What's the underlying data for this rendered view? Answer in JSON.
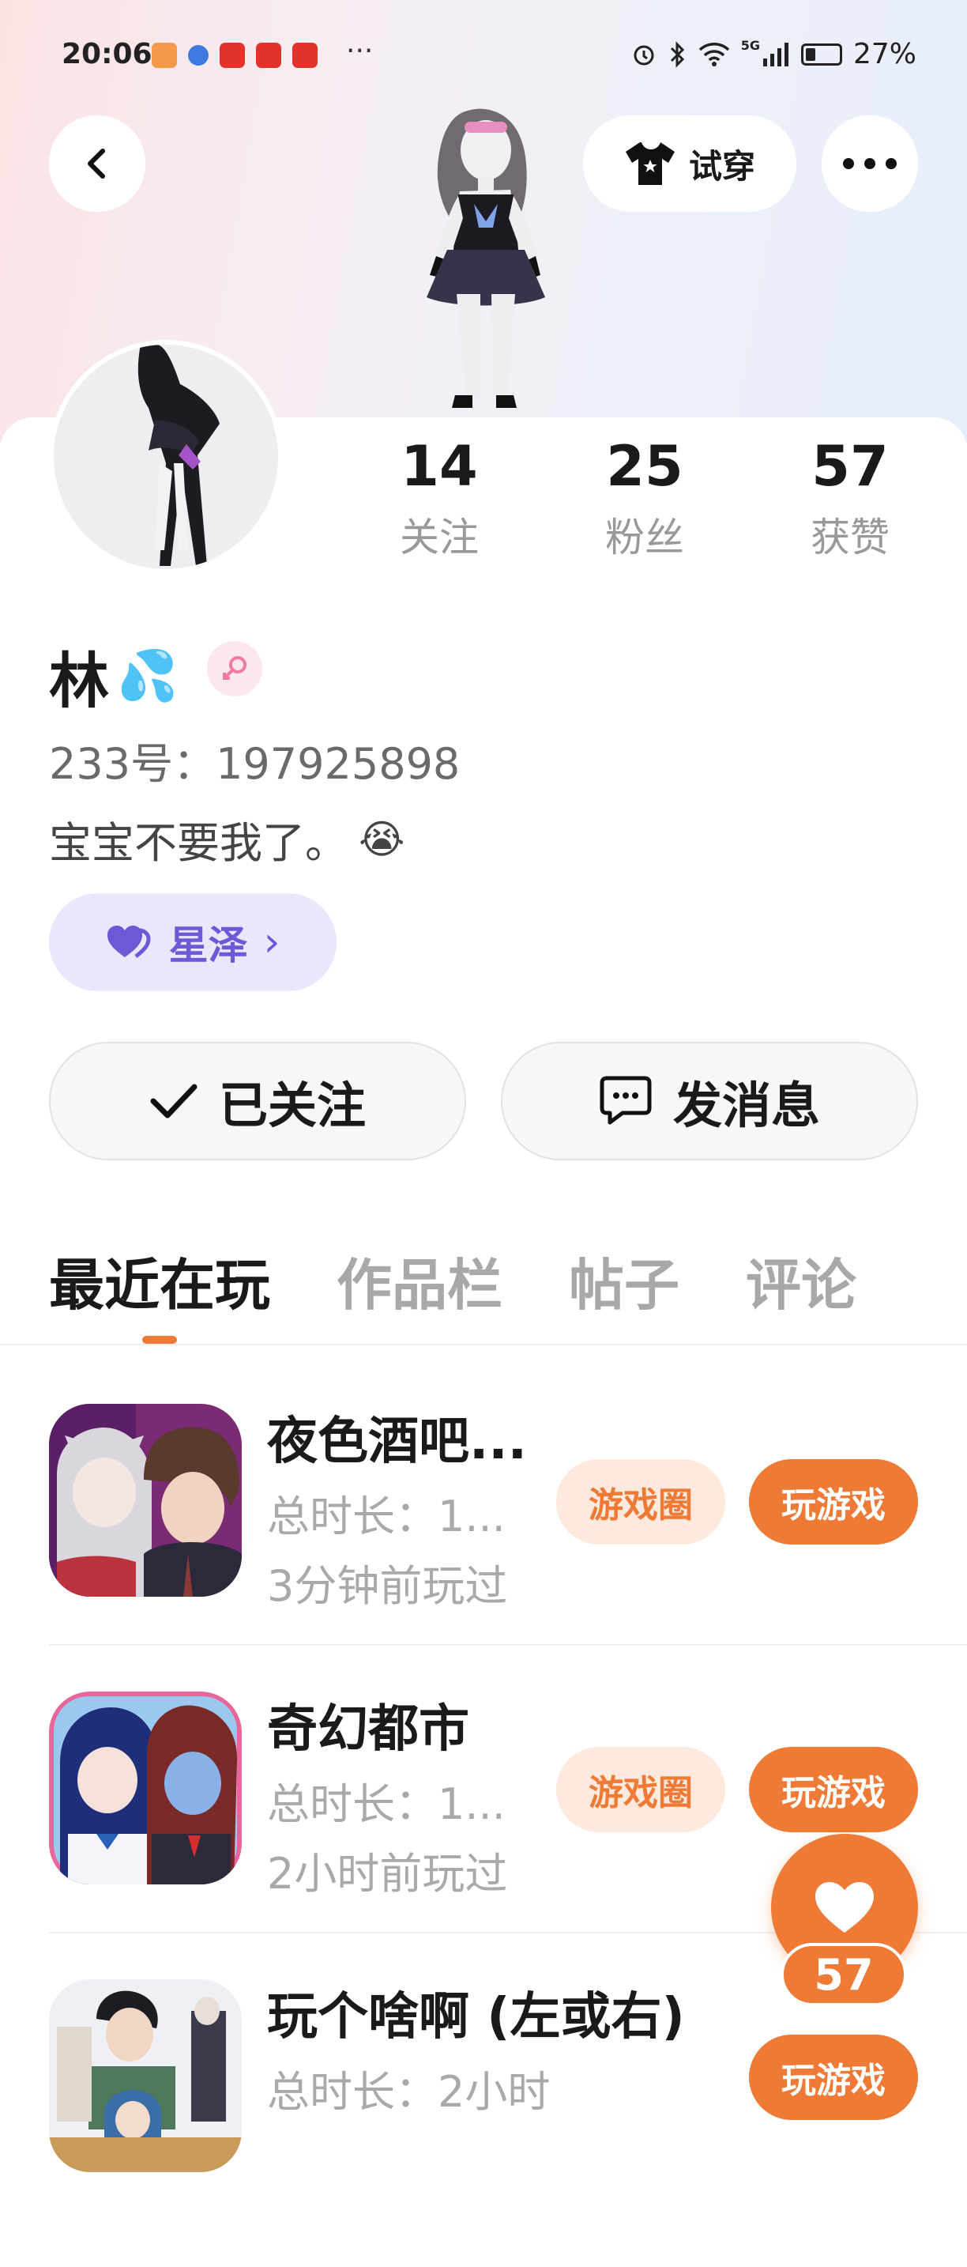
{
  "status_bar": {
    "time": "20:06",
    "overflow": "···",
    "battery": "27%",
    "network": "5G"
  },
  "header": {
    "back_icon": "chevron-left-icon",
    "try_on_label": "试穿",
    "more_icon": "more-dots-icon"
  },
  "stats": [
    {
      "num": "14",
      "label": "关注"
    },
    {
      "num": "25",
      "label": "粉丝"
    },
    {
      "num": "57",
      "label": "获赞"
    }
  ],
  "profile": {
    "name": "林",
    "name_emoji": "💦",
    "gender": "female",
    "uid": "233号：197925898",
    "bio": "宝宝不要我了。",
    "bio_emoji": "😭",
    "tag_label": "星泽",
    "tag_chevron": "›"
  },
  "actions": {
    "followed_label": "已关注",
    "message_label": "发消息"
  },
  "tabs": [
    {
      "label": "最近在玩",
      "active": true
    },
    {
      "label": "作品栏",
      "active": false
    },
    {
      "label": "帖子",
      "active": false
    },
    {
      "label": "评论",
      "active": false
    }
  ],
  "games": [
    {
      "title": "夜色酒吧...",
      "duration": "总时长：1...",
      "last_played": "3分钟前玩过",
      "circle_label": "游戏圈",
      "play_label": "玩游戏"
    },
    {
      "title": "奇幻都市",
      "duration": "总时长：1...",
      "last_played": "2小时前玩过",
      "circle_label": "游戏圈",
      "play_label": "玩游戏"
    },
    {
      "title": "玩个啥啊 (左或右)",
      "duration": "总时长：2小时",
      "last_played": "",
      "circle_label": "",
      "play_label": "玩游戏"
    }
  ],
  "like_fab": {
    "count": "57"
  },
  "colors": {
    "accent": "#ee7a35",
    "accent_soft": "#fde9dd",
    "tag_bg": "#ebe6fb",
    "tag_text": "#6f58d6"
  }
}
